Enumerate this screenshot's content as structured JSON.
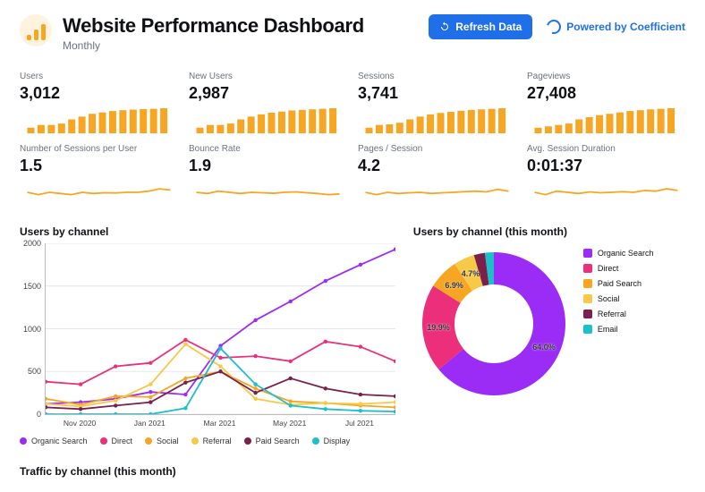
{
  "header": {
    "title": "Website Performance Dashboard",
    "subtitle": "Monthly",
    "refresh_label": "Refresh Data",
    "powered_by": "Powered by Coefficient"
  },
  "kpis": [
    {
      "label": "Users",
      "value": "3,012",
      "type": "bars",
      "series": [
        2,
        3,
        3,
        3.5,
        5,
        6,
        7,
        7.5,
        8,
        8.3,
        8.5,
        8.7,
        8.8,
        9
      ]
    },
    {
      "label": "New Users",
      "value": "2,987",
      "type": "bars",
      "series": [
        2,
        3,
        3,
        3.5,
        5,
        6,
        6.8,
        7.4,
        7.8,
        8.2,
        8.4,
        8.6,
        8.8,
        9
      ]
    },
    {
      "label": "Sessions",
      "value": "3,741",
      "type": "bars",
      "series": [
        2,
        3,
        3.2,
        3.8,
        5,
        6,
        6.8,
        7.3,
        7.7,
        8.1,
        8.4,
        8.6,
        8.8,
        9
      ]
    },
    {
      "label": "Pageviews",
      "value": "27,408",
      "type": "bars",
      "series": [
        2,
        2.5,
        3,
        3.5,
        5,
        5.8,
        6.5,
        7,
        7.5,
        8,
        8.3,
        8.6,
        8.8,
        9
      ]
    },
    {
      "label": "Number of Sessions per User",
      "value": "1.5",
      "type": "line",
      "series": [
        5,
        4,
        5,
        4.5,
        4,
        5,
        4.5,
        4.8,
        4.7,
        5,
        5,
        5.5,
        6.5,
        6
      ]
    },
    {
      "label": "Bounce Rate",
      "value": "1.9",
      "type": "line",
      "series": [
        5,
        4.5,
        5.5,
        5,
        4.5,
        5,
        4.8,
        4.6,
        5,
        5.2,
        4.8,
        4.5,
        4,
        4.3
      ]
    },
    {
      "label": "Pages / Session",
      "value": "4.2",
      "type": "line",
      "series": [
        5,
        4,
        5,
        4.5,
        4.8,
        5,
        4.5,
        4.8,
        5,
        5.3,
        5.5,
        5.2,
        6.3,
        5.5
      ]
    },
    {
      "label": "Avg. Session Duration",
      "value": "0:01:37",
      "type": "line",
      "series": [
        5,
        4,
        5.5,
        5,
        4.5,
        5.2,
        4.8,
        5,
        5.3,
        5,
        5.8,
        5.5,
        6.5,
        5.8
      ]
    }
  ],
  "users_by_channel": {
    "title": "Users by channel",
    "legend": [
      "Organic Search",
      "Direct",
      "Social",
      "Referral",
      "Paid Search",
      "Display"
    ],
    "colors": [
      "#9b2cf5",
      "#ec2f7b",
      "#f6a623",
      "#f7c948",
      "#7b1f4b",
      "#1bc0c9"
    ]
  },
  "donut": {
    "title": "Users by channel (this month)",
    "legend": [
      {
        "name": "Organic Search",
        "color": "#9b2cf5"
      },
      {
        "name": "Direct",
        "color": "#ec2f7b"
      },
      {
        "name": "Paid Search",
        "color": "#f6a623"
      },
      {
        "name": "Social",
        "color": "#f7c948"
      },
      {
        "name": "Referral",
        "color": "#7b1f4b"
      },
      {
        "name": "Email",
        "color": "#1bc0c9"
      }
    ],
    "labels": {
      "organic": "64.0%",
      "direct": "19.9%",
      "paid": "6.9%",
      "social": "4.7%"
    }
  },
  "traffic_title": "Traffic by channel (this month)",
  "chart_data": [
    {
      "type": "line",
      "title": "Users by channel",
      "xlabel": "",
      "ylabel": "",
      "ylim": [
        0,
        2000
      ],
      "yticks": [
        0,
        500,
        1000,
        1500,
        2000
      ],
      "x": [
        "Oct 2020",
        "Nov 2020",
        "Dec 2020",
        "Jan 2021",
        "Feb 2021",
        "Mar 2021",
        "Apr 2021",
        "May 2021",
        "Jun 2021",
        "Jul 2021",
        "Aug 2021"
      ],
      "xticks_shown": [
        "Nov 2020",
        "Jan 2021",
        "Mar 2021",
        "May 2021",
        "Jul 2021"
      ],
      "series": [
        {
          "name": "Organic Search",
          "color": "#9b2cf5",
          "values": [
            120,
            140,
            180,
            260,
            230,
            800,
            1100,
            1320,
            1560,
            1750,
            1930
          ]
        },
        {
          "name": "Direct",
          "color": "#ec2f7b",
          "values": [
            380,
            350,
            560,
            600,
            870,
            660,
            680,
            620,
            850,
            790,
            620
          ]
        },
        {
          "name": "Social",
          "color": "#f6a623",
          "values": [
            180,
            110,
            210,
            200,
            420,
            500,
            300,
            150,
            130,
            100,
            80
          ]
        },
        {
          "name": "Referral",
          "color": "#f7c948",
          "values": [
            120,
            90,
            160,
            350,
            820,
            560,
            180,
            110,
            130,
            120,
            140
          ]
        },
        {
          "name": "Paid Search",
          "color": "#7b1f4b",
          "values": [
            80,
            60,
            100,
            140,
            370,
            500,
            250,
            420,
            300,
            230,
            210
          ]
        },
        {
          "name": "Display",
          "color": "#1bc0c9",
          "values": [
            0,
            0,
            0,
            0,
            70,
            770,
            350,
            100,
            60,
            40,
            30
          ]
        }
      ]
    },
    {
      "type": "pie",
      "title": "Users by channel (this month)",
      "slices": [
        {
          "name": "Organic Search",
          "value": 64.0,
          "color": "#9b2cf5"
        },
        {
          "name": "Direct",
          "value": 19.9,
          "color": "#ec2f7b"
        },
        {
          "name": "Paid Search",
          "value": 6.9,
          "color": "#f6a623"
        },
        {
          "name": "Social",
          "value": 4.7,
          "color": "#f7c948"
        },
        {
          "name": "Referral",
          "value": 2.5,
          "color": "#7b1f4b"
        },
        {
          "name": "Email",
          "value": 2.0,
          "color": "#1bc0c9"
        }
      ]
    }
  ]
}
